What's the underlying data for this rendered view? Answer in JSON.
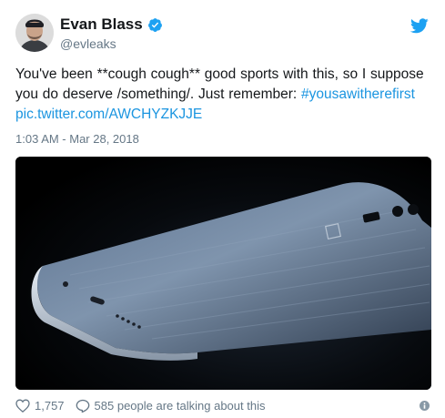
{
  "user": {
    "display_name": "Evan Blass",
    "handle": "@evleaks",
    "avatar_icon": "avatar-photo"
  },
  "tweet": {
    "text_main": "You've been **cough cough** good sports with this, so I suppose you do deserve /something/. Just remember: ",
    "hashtag": "#yousawitherefirst",
    "pic_link": "pic.twitter.com/AWCHYZKJJE",
    "timestamp": "1:03 AM - Mar 28, 2018",
    "image_icon": "smartphone-photo"
  },
  "actions": {
    "likes": "1,757",
    "talking": "585 people are talking about this",
    "like_icon": "heart-icon",
    "reply_icon": "comment-icon",
    "info_icon": "info-icon"
  },
  "colors": {
    "link": "#1b95e0",
    "muted": "#657786",
    "text": "#14171a",
    "brand": "#1da1f2"
  }
}
